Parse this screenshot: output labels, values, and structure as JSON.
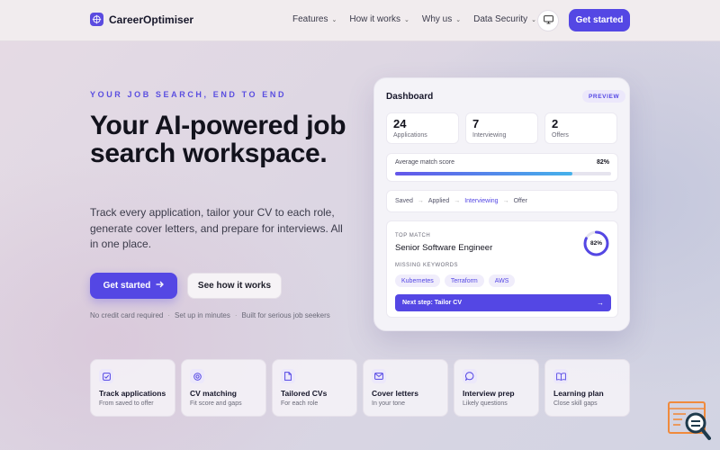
{
  "nav": {
    "brand": "CareerOptimiser",
    "links": [
      {
        "label": "Features"
      },
      {
        "label": "How it works"
      },
      {
        "label": "Why us"
      },
      {
        "label": "Data Security"
      }
    ],
    "cta": "Get started"
  },
  "hero": {
    "eyebrow": "YOUR JOB SEARCH, END TO END",
    "title": "Your AI-powered job search workspace.",
    "subtitle": "Track every application, tailor your CV to each role, generate cover letters, and prepare for interviews. All in one place.",
    "primary_button": "Get started",
    "secondary_button": "See how it works",
    "fineprint": [
      "No credit card required",
      "Set up in minutes",
      "Built for serious job seekers"
    ],
    "fineprint_separator": "·"
  },
  "dashboard": {
    "title": "Dashboard",
    "badge": "PREVIEW",
    "stats": [
      {
        "value": "24",
        "label": "Applications"
      },
      {
        "value": "7",
        "label": "Interviewing"
      },
      {
        "value": "2",
        "label": "Offers"
      }
    ],
    "match": {
      "label": "Average match score",
      "value": "82%",
      "fraction": 0.82
    },
    "pipeline": [
      "Saved",
      "Applied",
      "Interviewing",
      "Offer"
    ],
    "pipeline_active": "Interviewing",
    "top_match": {
      "eyebrow": "TOP MATCH",
      "role": "Senior Software Engineer",
      "score": "82%",
      "score_fraction": 0.82,
      "keywords_label": "MISSING KEYWORDS",
      "keywords": [
        "Kubernetes",
        "Terraform",
        "AWS"
      ],
      "next_step": "Next step: Tailor CV"
    }
  },
  "features": [
    {
      "title": "Track applications",
      "subtitle": "From saved to offer",
      "icon": "checkbox-icon"
    },
    {
      "title": "CV matching",
      "subtitle": "Fit score and gaps",
      "icon": "target-icon"
    },
    {
      "title": "Tailored CVs",
      "subtitle": "For each role",
      "icon": "document-icon"
    },
    {
      "title": "Cover letters",
      "subtitle": "In your tone",
      "icon": "mail-icon"
    },
    {
      "title": "Interview prep",
      "subtitle": "Likely questions",
      "icon": "chat-bubble-icon"
    },
    {
      "title": "Learning plan",
      "subtitle": "Close skill gaps",
      "icon": "book-icon"
    }
  ],
  "colors": {
    "accent": "#5447e4",
    "accent_soft": "#ece8fb",
    "match_gradient_end": "#45b2ea"
  }
}
